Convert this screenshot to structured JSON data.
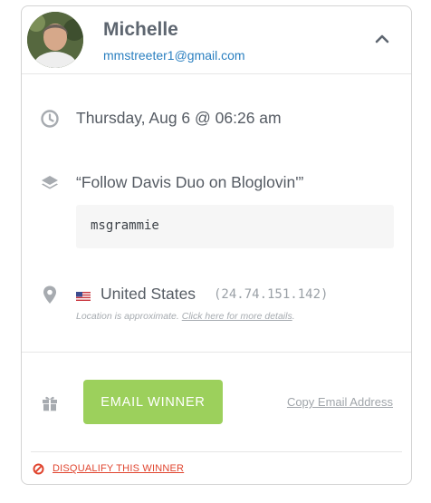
{
  "winner": {
    "name": "Michelle",
    "email": "mmstreeter1@gmail.com"
  },
  "details": {
    "datetime": "Thursday, Aug 6 @ 06:26 am",
    "entry_title": "“Follow Davis Duo on Bloglovin'”",
    "entry_value": "msgrammie",
    "country": "United States",
    "ip": "(24.74.151.142)",
    "location_note": "Location is approximate.",
    "location_link": "Click here for more details",
    "location_note_end": "."
  },
  "actions": {
    "email_button": "EMAIL WINNER",
    "copy_email": "Copy Email Address",
    "disqualify": "DISQUALIFY THIS WINNER"
  },
  "icons": {
    "collapse": "chevron-up-icon",
    "time": "clock-icon",
    "entry": "layers-icon",
    "location": "map-pin-icon",
    "flag": "us-flag-icon",
    "prize": "gift-icon",
    "disqualify": "ban-icon"
  },
  "colors": {
    "accent_button": "#9cd05c",
    "email_link": "#2a7fc0",
    "danger": "#e0452f",
    "icon_gray": "#a7abb0"
  }
}
